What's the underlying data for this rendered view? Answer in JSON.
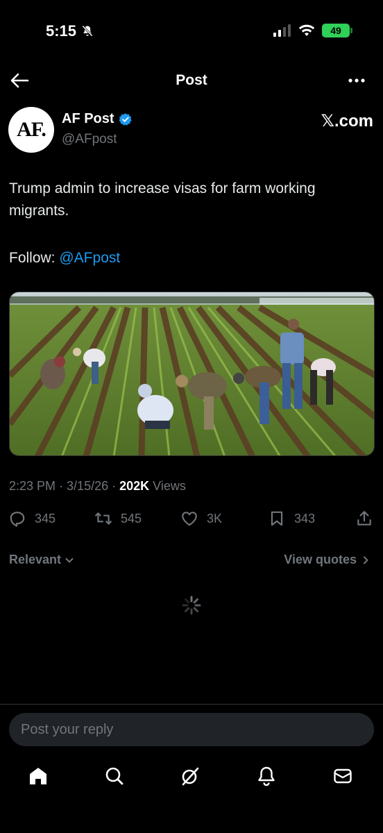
{
  "status_bar": {
    "time": "5:15",
    "battery": "49"
  },
  "nav": {
    "title": "Post"
  },
  "post": {
    "author_name": "AF Post",
    "author_handle": "@AFpost",
    "avatar_text": "AF.",
    "source_label": "𝕏.com",
    "text": "Trump admin to increase visas for farm working migrants.",
    "follow_label": "Follow: ",
    "follow_mention": "@AFpost",
    "time": "2:23 PM",
    "date": "3/15/26",
    "views_count": "202K",
    "views_label": "Views"
  },
  "actions": {
    "replies": "345",
    "reposts": "545",
    "likes": "3K",
    "bookmarks": "343"
  },
  "sort": {
    "relevant_label": "Relevant",
    "view_quotes_label": "View quotes"
  },
  "reply": {
    "placeholder": "Post your reply"
  },
  "icons": {
    "back": "arrow-left-icon",
    "more": "more-icon",
    "verified": "verified-badge-icon",
    "reply": "reply-icon",
    "repost": "repost-icon",
    "like": "heart-icon",
    "bookmark": "bookmark-icon",
    "share": "share-icon",
    "home": "home-icon",
    "search": "search-icon",
    "grok": "grok-icon",
    "notifications": "bell-icon",
    "messages": "mail-icon"
  },
  "colors": {
    "accent": "#1d9bf0",
    "muted": "#71767b",
    "background": "#000000",
    "battery": "#30d158"
  }
}
